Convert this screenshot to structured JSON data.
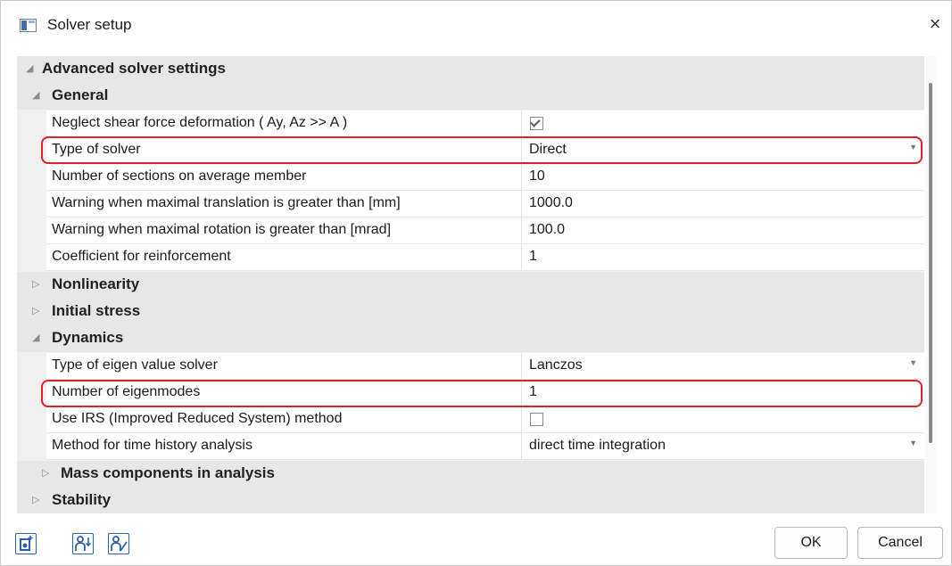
{
  "window": {
    "title": "Solver setup",
    "close_glyph": "×"
  },
  "tree": {
    "advanced": {
      "label": "Advanced solver settings",
      "expanded": true
    },
    "general": {
      "label": "General",
      "rows": [
        {
          "label": "Neglect shear force deformation ( Ay, Az >> A )",
          "type": "checkbox",
          "checked": true
        },
        {
          "label": "Type of solver",
          "value": "Direct",
          "type": "dropdown"
        },
        {
          "label": "Number of sections on average member",
          "value": "10"
        },
        {
          "label": "Warning when maximal translation is greater than [mm]",
          "value": "1000.0"
        },
        {
          "label": "Warning when maximal rotation is greater than [mrad]",
          "value": "100.0"
        },
        {
          "label": "Coefficient for reinforcement",
          "value": "1"
        }
      ]
    },
    "nonlinearity": {
      "label": "Nonlinearity",
      "expanded": false
    },
    "initial_stress": {
      "label": "Initial stress",
      "expanded": false
    },
    "dynamics": {
      "label": "Dynamics",
      "rows": [
        {
          "label": "Type of eigen value solver",
          "value": "Lanczos",
          "type": "dropdown"
        },
        {
          "label": "Number of eigenmodes",
          "value": "1"
        },
        {
          "label": "Use IRS (Improved Reduced System) method",
          "type": "checkbox",
          "checked": false
        },
        {
          "label": "Method for time history analysis",
          "value": "direct time integration",
          "type": "dropdown"
        }
      ]
    },
    "mass_components": {
      "label": "Mass components in analysis",
      "expanded": false
    },
    "stability": {
      "label": "Stability",
      "expanded": false
    }
  },
  "icons": {
    "expanded": "expanded-triangle-icon",
    "collapsed": "collapsed-triangle-icon",
    "dropdown": "chevron-down-icon"
  },
  "highlight_color": "#e0202a",
  "footer": {
    "tools": [
      "add-document-icon",
      "sort-users-icon",
      "user-settings-icon"
    ],
    "ok_label": "OK",
    "cancel_label": "Cancel"
  }
}
